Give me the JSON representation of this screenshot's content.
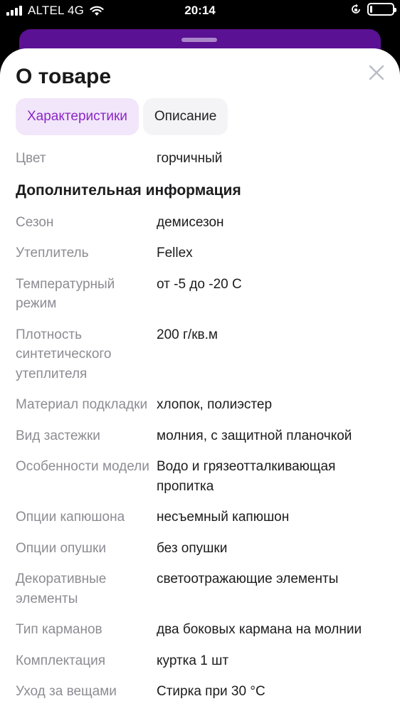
{
  "status_bar": {
    "carrier": "ALTEL 4G",
    "time": "20:14",
    "signal_bars": 4,
    "battery_level": 0.1
  },
  "icons": {
    "signal": "cellular-signal-icon",
    "wifi": "wifi-icon",
    "orientation_lock": "orientation-lock-icon",
    "battery": "battery-icon",
    "close": "close-icon"
  },
  "sheet": {
    "title": "О товаре",
    "tabs": [
      {
        "label": "Характеристики",
        "active": true
      },
      {
        "label": "Описание",
        "active": false
      }
    ]
  },
  "main_specs": [
    {
      "label": "Цвет",
      "value": "горчичный"
    }
  ],
  "additional": {
    "heading": "Дополнительная информация",
    "items": [
      {
        "label": "Сезон",
        "value": "демисезон"
      },
      {
        "label": "Утеплитель",
        "value": "Fellex"
      },
      {
        "label": "Температурный режим",
        "value": "от -5 до -20 С"
      },
      {
        "label": "Плотность синтетического утеплителя",
        "value": "200 г/кв.м"
      },
      {
        "label": "Материал подкладки",
        "value": "хлопок, полиэстер"
      },
      {
        "label": "Вид застежки",
        "value": "молния, с защитной планочкой"
      },
      {
        "label": "Особенности модели",
        "value": "Водо и грязеотталкивающая пропитка"
      },
      {
        "label": "Опции капюшона",
        "value": "несъемный капюшон"
      },
      {
        "label": "Опции опушки",
        "value": "без опушки"
      },
      {
        "label": "Декоративные элементы",
        "value": "светоотражающие элементы"
      },
      {
        "label": "Тип карманов",
        "value": "два боковых кармана на молнии"
      },
      {
        "label": "Комплектация",
        "value": "куртка 1 шт"
      },
      {
        "label": "Уход за вещами",
        "value": "Стирка при 30 °С"
      }
    ]
  },
  "colors": {
    "accent": "#8a27c7",
    "accent_bg": "#f2e6fa",
    "header_purple": "#5b1193",
    "label_gray": "#8c8c93"
  }
}
